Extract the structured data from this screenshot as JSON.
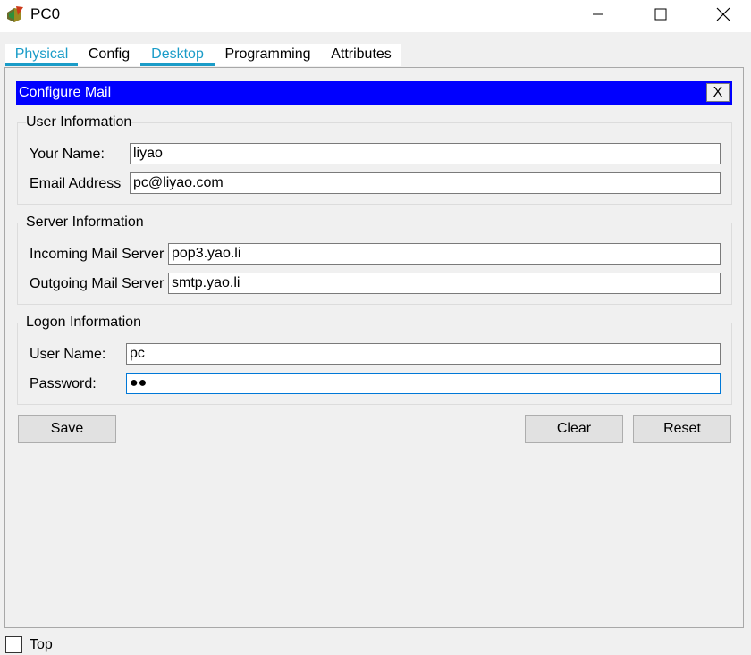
{
  "window": {
    "title": "PC0",
    "controls": {
      "minimize": "minimize-icon",
      "maximize": "maximize-icon",
      "close": "close-icon"
    }
  },
  "tabs": [
    {
      "label": "Physical",
      "active": true
    },
    {
      "label": "Config",
      "active": false
    },
    {
      "label": "Desktop",
      "active": true
    },
    {
      "label": "Programming",
      "active": false
    },
    {
      "label": "Attributes",
      "active": false
    }
  ],
  "app": {
    "title": "Configure Mail",
    "close_label": "X",
    "header_color": "#0000ff"
  },
  "user_info": {
    "legend": "User Information",
    "name_label": "Your Name:",
    "name_value": "liyao",
    "email_label": "Email Address",
    "email_value": "pc@liyao.com"
  },
  "server_info": {
    "legend": "Server Information",
    "incoming_label": "Incoming Mail Server",
    "incoming_value": "pop3.yao.li",
    "outgoing_label": "Outgoing Mail Server",
    "outgoing_value": "smtp.yao.li"
  },
  "logon_info": {
    "legend": "Logon Information",
    "username_label": "User Name:",
    "username_value": "pc",
    "password_label": "Password:",
    "password_value": "●●"
  },
  "buttons": {
    "save": "Save",
    "clear": "Clear",
    "reset": "Reset"
  },
  "footer": {
    "top_label": "Top",
    "top_checked": false
  },
  "colors": {
    "accent_tab": "#1a9cc8",
    "focus_border": "#0078d7"
  }
}
